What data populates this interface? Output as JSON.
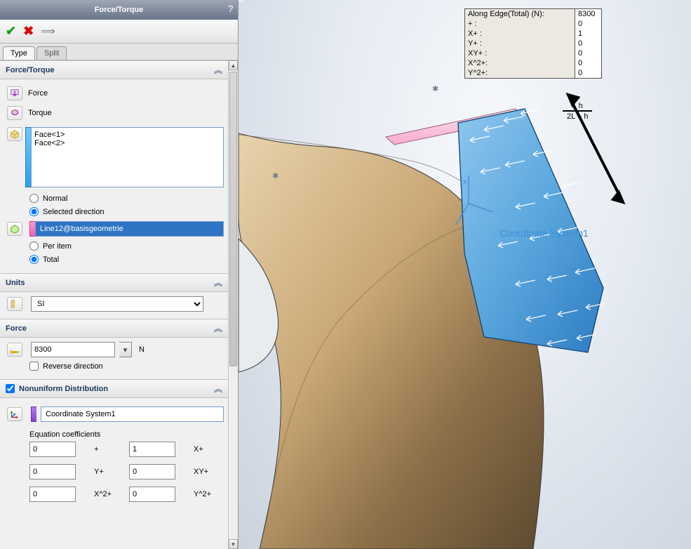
{
  "title": "Force/Torque",
  "tabs": {
    "type": "Type",
    "split": "Split"
  },
  "sections": {
    "forcetorque": {
      "header": "Force/Torque",
      "force": "Force",
      "torque": "Torque",
      "faces": "Face<1>\nFace<2>",
      "normal": "Normal",
      "selected_direction": "Selected direction",
      "direction_ref": "Line12@basisgeometrie",
      "per_item": "Per item",
      "total": "Total"
    },
    "units": {
      "header": "Units",
      "value": "SI"
    },
    "force": {
      "header": "Force",
      "value": "8300",
      "unit": "N",
      "reverse": "Reverse direction"
    },
    "nonuniform": {
      "header": "Nonuniform Distribution",
      "csys": "Coordinate System1",
      "eq_label": "Equation coefficients",
      "coefs": {
        "const": "0",
        "const_lab": "+",
        "x": "1",
        "x_lab": "X+",
        "y": "0",
        "y_lab": "Y+",
        "xy": "0",
        "xy_lab": "XY+",
        "x2": "0",
        "x2_lab": "X^2+",
        "y2": "0",
        "y2_lab": "Y^2+"
      }
    }
  },
  "hud": {
    "title": "Along Edge(Total) (N):",
    "total": "8300",
    "rows": [
      {
        "k": "+   :",
        "v": "0"
      },
      {
        "k": "X+  :",
        "v": "1"
      },
      {
        "k": "Y+  :",
        "v": "0"
      },
      {
        "k": "XY+ :",
        "v": "0"
      },
      {
        "k": "X^2+:",
        "v": "0"
      },
      {
        "k": "Y^2+:",
        "v": "0"
      }
    ]
  },
  "formula": {
    "num": "L h",
    "den": "2L + h"
  },
  "csys_label": "Coordinate System1"
}
